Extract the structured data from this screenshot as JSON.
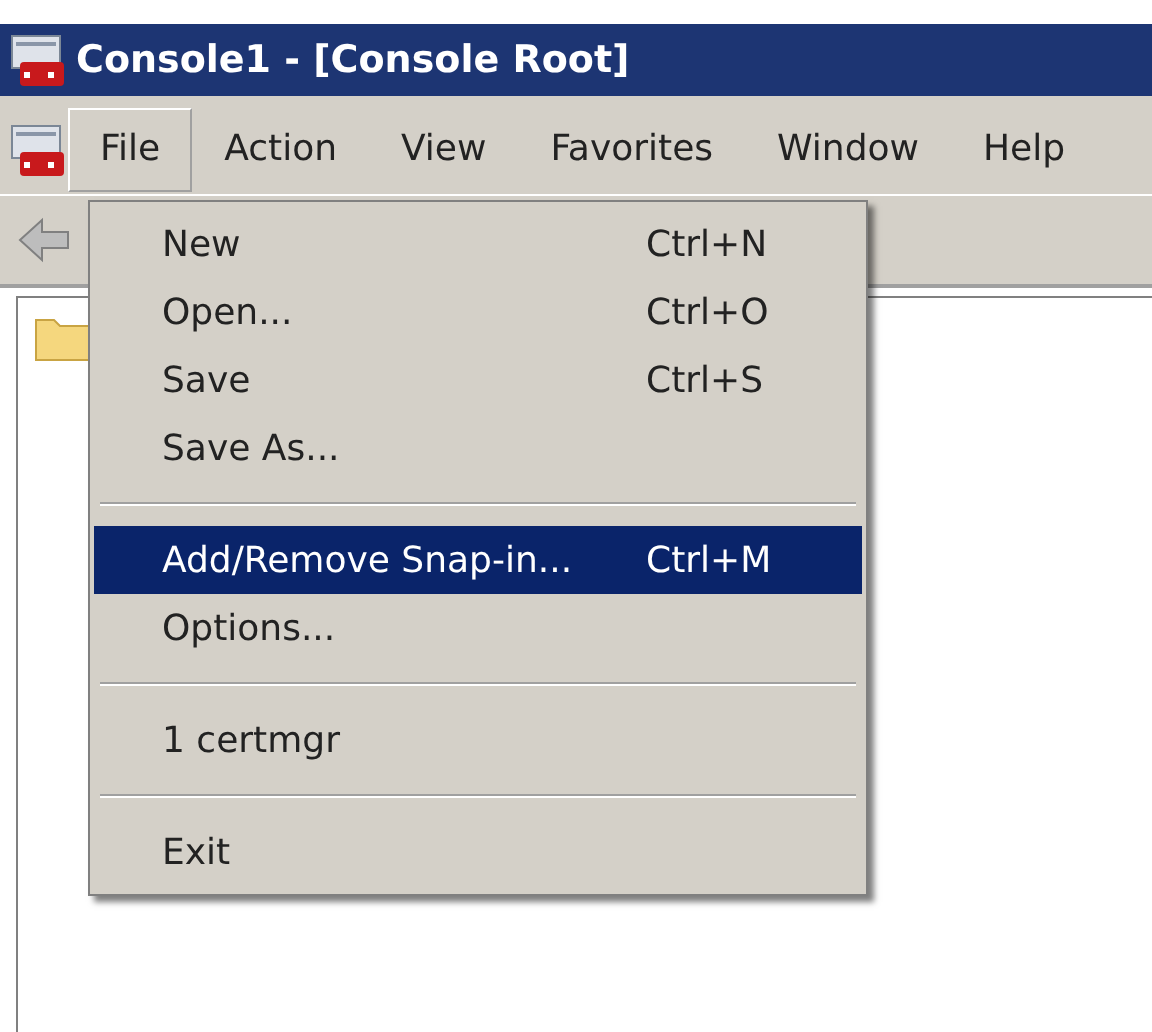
{
  "window": {
    "title": "Console1 - [Console Root]"
  },
  "menu_bar": [
    {
      "label": "File",
      "selected": true
    },
    {
      "label": "Action",
      "selected": false
    },
    {
      "label": "View",
      "selected": false
    },
    {
      "label": "Favorites",
      "selected": false
    },
    {
      "label": "Window",
      "selected": false
    },
    {
      "label": "Help",
      "selected": false
    }
  ],
  "file_menu": [
    {
      "kind": "item",
      "label": "New",
      "shortcut": "Ctrl+N",
      "selected": false
    },
    {
      "kind": "item",
      "label": "Open...",
      "shortcut": "Ctrl+O",
      "selected": false
    },
    {
      "kind": "item",
      "label": "Save",
      "shortcut": "Ctrl+S",
      "selected": false
    },
    {
      "kind": "item",
      "label": "Save As...",
      "selected": false
    },
    {
      "kind": "separator"
    },
    {
      "kind": "item",
      "label": "Add/Remove Snap-in...",
      "shortcut": "Ctrl+M",
      "selected": true
    },
    {
      "kind": "item",
      "label": "Options...",
      "selected": false
    },
    {
      "kind": "separator"
    },
    {
      "kind": "item",
      "label": "1 certmgr",
      "selected": false
    },
    {
      "kind": "separator"
    },
    {
      "kind": "item",
      "label": "Exit",
      "selected": false
    }
  ]
}
